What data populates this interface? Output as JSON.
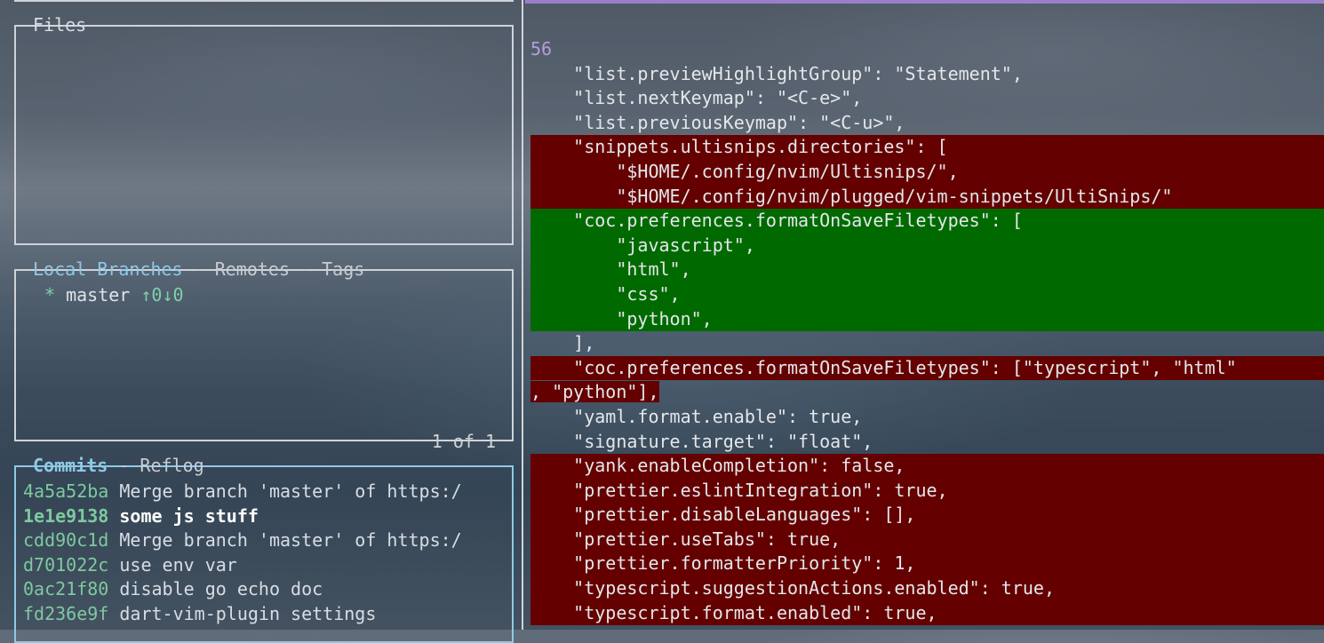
{
  "panels": {
    "files": {
      "title": "Files"
    },
    "branches": {
      "title_active": "Local Branches",
      "sep1": " - ",
      "title_remotes": "Remotes",
      "sep2": " - ",
      "title_tags": "Tags",
      "footer": "1 of 1",
      "items": [
        {
          "marker": "*",
          "name": "master",
          "status": "↑0↓0"
        }
      ]
    },
    "commits": {
      "title_active": "Commits",
      "sep": " - ",
      "title_reflog": "Reflog",
      "items": [
        {
          "sha": "4a5a52ba",
          "message": "Merge branch 'master' of https:/"
        },
        {
          "sha": "1e1e9138",
          "message": "some js stuff"
        },
        {
          "sha": "cdd90c1d",
          "message": "Merge branch 'master' of https:/"
        },
        {
          "sha": "d701022c",
          "message": "use env var"
        },
        {
          "sha": "0ac21f80",
          "message": "disable go echo doc"
        },
        {
          "sha": "fd236e9f",
          "message": "dart-vim-plugin settings"
        }
      ]
    }
  },
  "diff": {
    "hunk_number": "56",
    "lines": [
      {
        "type": "context",
        "text": "    \"list.previewHighlightGroup\": \"Statement\","
      },
      {
        "type": "context",
        "text": "    \"list.nextKeymap\": \"<C-e>\","
      },
      {
        "type": "context",
        "text": "    \"list.previousKeymap\": \"<C-u>\","
      },
      {
        "type": "removed",
        "text": "    \"snippets.ultisnips.directories\": ["
      },
      {
        "type": "removed",
        "text": "        \"$HOME/.config/nvim/Ultisnips/\","
      },
      {
        "type": "removed",
        "text": "        \"$HOME/.config/nvim/plugged/vim-snippets/UltiSnips/\""
      },
      {
        "type": "added",
        "text": "    \"coc.preferences.formatOnSaveFiletypes\": ["
      },
      {
        "type": "added",
        "text": "        \"javascript\","
      },
      {
        "type": "added",
        "text": "        \"html\","
      },
      {
        "type": "added",
        "text": "        \"css\","
      },
      {
        "type": "added",
        "text": "        \"python\","
      },
      {
        "type": "context",
        "text": "    ],"
      },
      {
        "type": "removed",
        "text": "    \"coc.preferences.formatOnSaveFiletypes\": [\"typescript\", \"html\""
      },
      {
        "type": "removed-wrap",
        "text": ", \"python\"],"
      },
      {
        "type": "context",
        "text": "    \"yaml.format.enable\": true,"
      },
      {
        "type": "context",
        "text": "    \"signature.target\": \"float\","
      },
      {
        "type": "removed",
        "text": "    \"yank.enableCompletion\": false,"
      },
      {
        "type": "removed",
        "text": "    \"prettier.eslintIntegration\": true,"
      },
      {
        "type": "removed",
        "text": "    \"prettier.disableLanguages\": [],"
      },
      {
        "type": "removed",
        "text": "    \"prettier.useTabs\": true,"
      },
      {
        "type": "removed",
        "text": "    \"prettier.formatterPriority\": 1,"
      },
      {
        "type": "removed",
        "text": "    \"typescript.suggestionActions.enabled\": true,"
      },
      {
        "type": "removed",
        "text": "    \"typescript.format.enabled\": true,"
      }
    ]
  },
  "colors": {
    "removed_bg": "#640000",
    "added_bg": "#006a00",
    "active_border": "#8ec9e6",
    "sha": "#7ec9a0",
    "hunk": "#b39ddb"
  }
}
